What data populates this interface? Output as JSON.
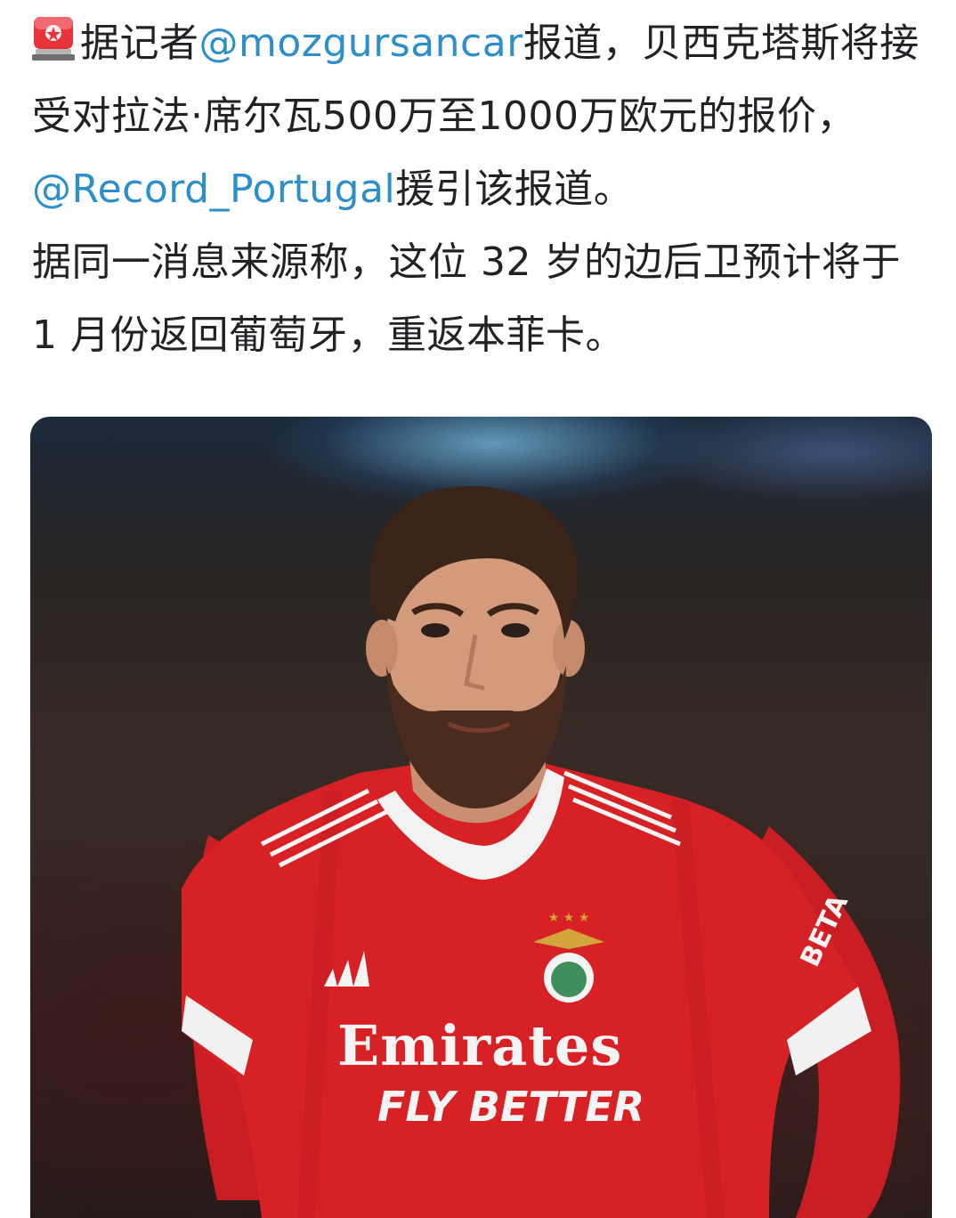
{
  "post": {
    "icon": "siren-icon",
    "line1_prefix": "据记者",
    "mention1": "@mozgursancar",
    "line1_suffix": "报道，贝西克塔斯将接受对拉法·席尔瓦500万至1000万欧元的报价，",
    "mention2": "@Record_Portugal",
    "line1_end": "援引该报道。",
    "paragraph2": "据同一消息来源称，这位 32 岁的边后卫预计将于 1 月份返回葡萄牙，重返本菲卡。"
  },
  "photo": {
    "sponsor_main": "Emirates",
    "sponsor_sub": "FLY BETTER",
    "sleeve_sponsor": "BETA",
    "colors": {
      "shirt": "#d72125",
      "mention": "#2c8fc9"
    }
  }
}
